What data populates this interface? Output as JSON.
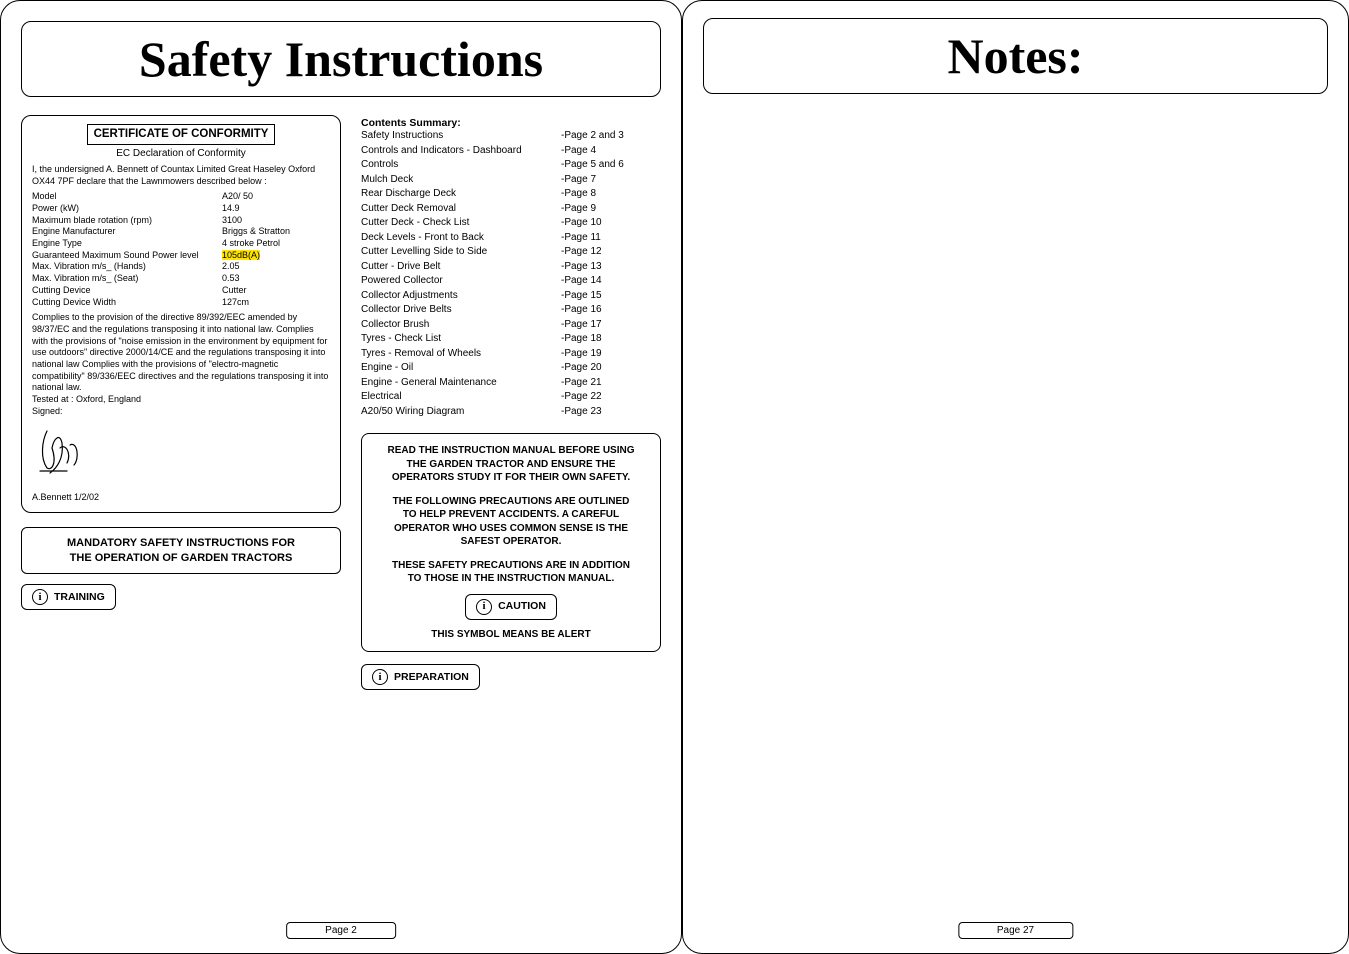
{
  "leftPage": {
    "title": "Safety Instructions",
    "pageNumber": "Page 2",
    "conformity": {
      "heading": "CERTIFICATE OF CONFORMITY",
      "subheading": "EC Declaration of Conformity",
      "intro": "I, the undersigned A. Bennett of Countax Limited Great Haseley Oxford OX44 7PF declare that the Lawnmowers described below :",
      "specs": [
        {
          "label": "Model",
          "value": "A20/ 50"
        },
        {
          "label": "Power (kW)",
          "value": "14.9"
        },
        {
          "label": "Maximum blade rotation (rpm)",
          "value": "3100"
        },
        {
          "label": "Engine Manufacturer",
          "value": "Briggs & Stratton"
        },
        {
          "label": "Engine Type",
          "value": "4 stroke Petrol",
          "hl": false,
          "valueHlPartial": "4 stroke"
        },
        {
          "label": "Guaranteed Maximum Sound Power level",
          "value": "105dB(A)",
          "hl": true
        },
        {
          "label": "Max. Vibration m/s_ (Hands)",
          "value": "2.05"
        },
        {
          "label": "Max. Vibration m/s_ (Seat)",
          "value": "0.53"
        },
        {
          "label": "Cutting Device",
          "value": "Cutter"
        },
        {
          "label": "Cutting Device Width",
          "value": "127cm"
        }
      ],
      "compliance": "Complies to the provision of the directive 89/392/EEC amended by 98/37/EC and the regulations transposing it into national law. Complies with the provisions of \"noise emission in the environment by equipment for use outdoors\" directive 2000/14/CE and the regulations transposing it into national law Complies with the provisions of \"electro-magnetic compatibility\" 89/336/EEC directives and the regulations transposing it into national law.",
      "tested": "Tested at : Oxford, England",
      "signedLabel": "Signed:",
      "signer": "A.Bennett 1/2/02"
    },
    "mandatory": {
      "line1": "MANDATORY SAFETY INSTRUCTIONS FOR",
      "line2": "THE OPERATION OF GARDEN TRACTORS"
    },
    "trainingPill": "TRAINING",
    "contents": {
      "heading": "Contents Summary:",
      "items": [
        {
          "label": "Safety Instructions",
          "page": "-Page 2 and 3"
        },
        {
          "label": "Controls and Indicators - Dashboard",
          "page": "-Page 4"
        },
        {
          "label": "Controls",
          "page": "-Page 5 and 6"
        },
        {
          "label": "Mulch Deck",
          "page": "-Page 7"
        },
        {
          "label": "Rear Discharge Deck",
          "page": "-Page 8"
        },
        {
          "label": "Cutter Deck Removal",
          "page": "-Page 9"
        },
        {
          "label": "Cutter Deck - Check List",
          "page": "-Page 10"
        },
        {
          "label": "Deck Levels - Front to Back",
          "page": "-Page 11"
        },
        {
          "label": "Cutter Levelling Side to Side",
          "page": "-Page 12"
        },
        {
          "label": "Cutter - Drive Belt",
          "page": "-Page 13"
        },
        {
          "label": "Powered Collector",
          "page": "-Page 14"
        },
        {
          "label": "Collector Adjustments",
          "page": "-Page 15"
        },
        {
          "label": "Collector Drive Belts",
          "page": "-Page 16"
        },
        {
          "label": "Collector Brush",
          "page": "-Page 17"
        },
        {
          "label": "Tyres - Check List",
          "page": "-Page 18"
        },
        {
          "label": "Tyres - Removal of Wheels",
          "page": "-Page 19"
        },
        {
          "label": "Engine - Oil",
          "page": "-Page 20"
        },
        {
          "label": "Engine - General Maintenance",
          "page": "-Page 21"
        },
        {
          "label": "Electrical",
          "page": "-Page 22"
        },
        {
          "label": "A20/50 Wiring Diagram",
          "page": "-Page 23"
        }
      ]
    },
    "safetyBox": {
      "p1l1": "READ THE INSTRUCTION MANUAL BEFORE USING",
      "p1l2": "THE GARDEN TRACTOR AND ENSURE THE",
      "p1l3": "OPERATORS STUDY IT FOR THEIR OWN SAFETY.",
      "p2l1": "THE FOLLOWING PRECAUTIONS ARE OUTLINED",
      "p2l2": "TO HELP PREVENT ACCIDENTS. A CAREFUL",
      "p2l3": "OPERATOR WHO USES COMMON SENSE IS THE",
      "p2l4": "SAFEST OPERATOR.",
      "p3l1": "THESE SAFETY PRECAUTIONS ARE IN ADDITION",
      "p3l2": "TO THOSE IN THE INSTRUCTION MANUAL.",
      "caution": "CAUTION",
      "beAlert": "THIS SYMBOL MEANS BE ALERT"
    },
    "preparationPill": "PREPARATION"
  },
  "rightPage": {
    "title": "Notes:",
    "pageNumber": "Page 27"
  }
}
